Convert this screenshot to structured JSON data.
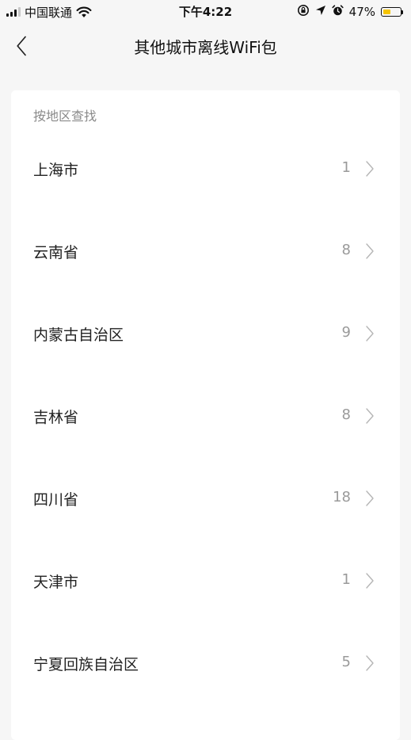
{
  "status_bar": {
    "carrier": "中国联通",
    "time": "下午4:22",
    "battery_percent": "47%",
    "battery_level": 0.47,
    "battery_color": "#f6c400"
  },
  "nav": {
    "title": "其他城市离线WiFi包",
    "back_icon": "chevron-left-icon"
  },
  "section": {
    "header": "按地区查找"
  },
  "regions": [
    {
      "name": "上海市",
      "count": "1"
    },
    {
      "name": "云南省",
      "count": "8"
    },
    {
      "name": "内蒙古自治区",
      "count": "9"
    },
    {
      "name": "吉林省",
      "count": "8"
    },
    {
      "name": "四川省",
      "count": "18"
    },
    {
      "name": "天津市",
      "count": "1"
    },
    {
      "name": "宁夏回族自治区",
      "count": "5"
    }
  ]
}
